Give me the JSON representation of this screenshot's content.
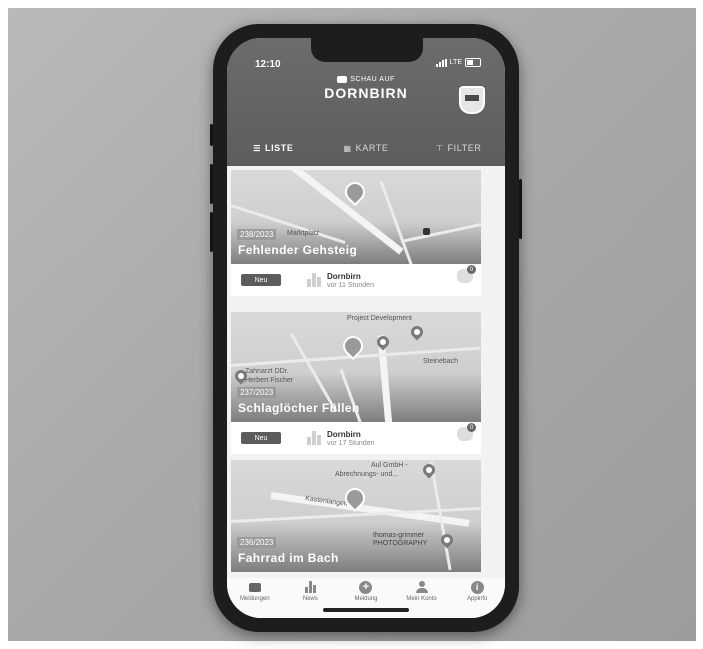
{
  "status_bar": {
    "time": "12:10",
    "network": "LTE"
  },
  "app": {
    "brand_top": "SCHAU AUF",
    "brand_main": "DORNBIRN"
  },
  "tabs": [
    {
      "label": "LISTE",
      "icon": "list-icon",
      "active": true
    },
    {
      "label": "KARTE",
      "icon": "map-icon",
      "active": false
    },
    {
      "label": "FILTER",
      "icon": "filter-icon",
      "active": false
    }
  ],
  "cards": [
    {
      "number": "238/2023",
      "title": "Fehlender Gehsteig",
      "status": "Neu",
      "place": "Dornbirn",
      "time": "vor 11 Stunden",
      "comments": "0",
      "map_labels": [
        "Marktplatz"
      ]
    },
    {
      "number": "237/2023",
      "title": "Schlaglöcher Füllen",
      "status": "Neu",
      "place": "Dornbirn",
      "time": "vor 17 Stunden",
      "comments": "0",
      "map_labels": [
        "Project Development",
        "Steinebach",
        "Zahnarzt DDr.",
        "Herbert Fischer"
      ]
    },
    {
      "number": "236/2023",
      "title": "Fahrrad im Bach",
      "map_labels": [
        "Aul GmbH -",
        "Abrechnungs- und...",
        "Kastenlangen",
        "thomas-grimmer",
        "PHOTOGRAPHY"
      ]
    }
  ],
  "bottom_nav": [
    {
      "label": "Meldungen",
      "icon": "chat-icon"
    },
    {
      "label": "News",
      "icon": "city-icon"
    },
    {
      "label": "Meldung",
      "icon": "plus-circle-icon"
    },
    {
      "label": "Mein Konto",
      "icon": "user-icon"
    },
    {
      "label": "Appinfo",
      "icon": "info-icon"
    }
  ]
}
